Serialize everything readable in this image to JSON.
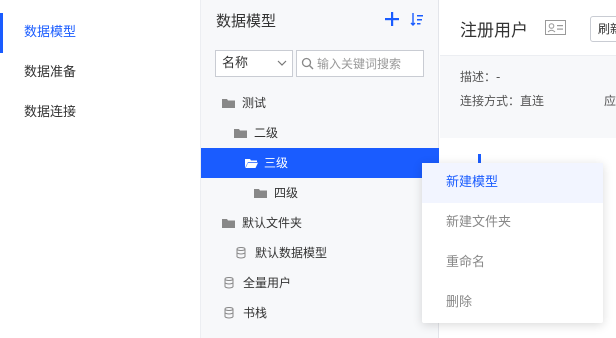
{
  "colors": {
    "accent": "#1a5cff",
    "panel_bg": "#f7f8fa"
  },
  "nav": {
    "items": [
      {
        "label": "数据模型",
        "active": true
      },
      {
        "label": "数据准备",
        "active": false
      },
      {
        "label": "数据连接",
        "active": false
      }
    ]
  },
  "tree": {
    "title": "数据模型",
    "add_icon": "plus-icon",
    "sort_icon": "sort-icon",
    "filter": {
      "selected": "名称"
    },
    "search": {
      "placeholder": "输入关键词搜索",
      "value": ""
    },
    "nodes": [
      {
        "label": "测试",
        "icon": "folder-icon"
      },
      {
        "label": "二级",
        "icon": "folder-icon"
      },
      {
        "label": "三级",
        "icon": "folder-open-icon",
        "selected": true
      },
      {
        "label": "四级",
        "icon": "folder-icon"
      },
      {
        "label": "默认文件夹",
        "icon": "folder-icon"
      },
      {
        "label": "默认数据模型",
        "icon": "database-icon"
      },
      {
        "label": "全量用户",
        "icon": "database-icon"
      },
      {
        "label": "书栈",
        "icon": "database-icon"
      }
    ]
  },
  "detail": {
    "title": "注册用户",
    "card_icon": "id-card-icon",
    "refresh_label": "刷新",
    "description": "描述：-",
    "connection": "连接方式：直连",
    "truncated_label": "应"
  },
  "context_menu": {
    "items": [
      {
        "label": "新建模型",
        "hover": true
      },
      {
        "label": "新建文件夹"
      },
      {
        "label": "重命名"
      },
      {
        "label": "删除"
      }
    ]
  }
}
